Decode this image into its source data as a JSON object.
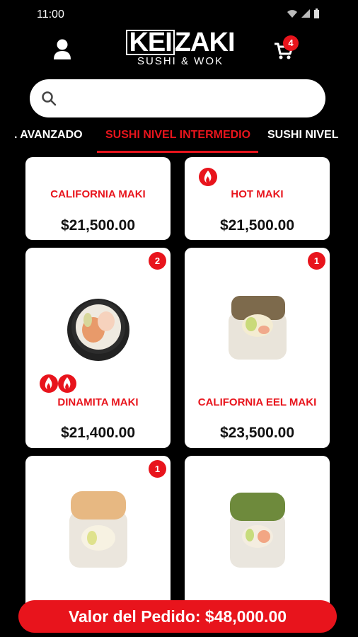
{
  "status_bar": {
    "time": "11:00"
  },
  "header": {
    "logo_main_a": "KEI",
    "logo_main_b": "ZAKI",
    "logo_sub": "SUSHI & WOK",
    "cart_count": "4"
  },
  "search": {
    "placeholder": "",
    "value": ""
  },
  "tabs": [
    {
      "label": "AVANZADO",
      "active": false
    },
    {
      "label": "SUSHI NIVEL INTERMEDIO",
      "active": true
    },
    {
      "label": "SUSHI NIVEL",
      "active": false
    }
  ],
  "products": [
    {
      "name": "CALIFORNIA MAKI",
      "price": "$21,500.00",
      "qty": "",
      "spicy": 0
    },
    {
      "name": "HOT MAKI",
      "price": "$21,500.00",
      "qty": "",
      "spicy": 1
    },
    {
      "name": "DINAMITA MAKI",
      "price": "$21,400.00",
      "qty": "2",
      "spicy": 2
    },
    {
      "name": "CALIFORNIA EEL MAKI",
      "price": "$23,500.00",
      "qty": "1",
      "spicy": 0
    },
    {
      "name": "",
      "price": "",
      "qty": "1",
      "spicy": 0
    },
    {
      "name": "",
      "price": "",
      "qty": "",
      "spicy": 0
    }
  ],
  "order": {
    "label": "Valor del Pedido: $48,000.00"
  },
  "colors": {
    "accent": "#e8141c",
    "background": "#000000",
    "card": "#ffffff"
  }
}
